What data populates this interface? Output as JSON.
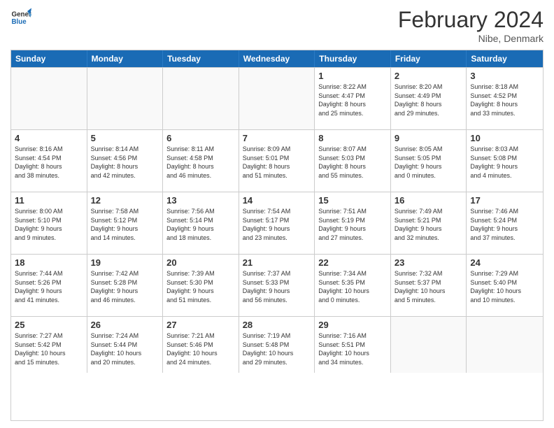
{
  "logo": {
    "line1": "General",
    "line2": "Blue"
  },
  "title": "February 2024",
  "subtitle": "Nibe, Denmark",
  "days": [
    "Sunday",
    "Monday",
    "Tuesday",
    "Wednesday",
    "Thursday",
    "Friday",
    "Saturday"
  ],
  "weeks": [
    [
      {
        "day": "",
        "info": ""
      },
      {
        "day": "",
        "info": ""
      },
      {
        "day": "",
        "info": ""
      },
      {
        "day": "",
        "info": ""
      },
      {
        "day": "1",
        "info": "Sunrise: 8:22 AM\nSunset: 4:47 PM\nDaylight: 8 hours\nand 25 minutes."
      },
      {
        "day": "2",
        "info": "Sunrise: 8:20 AM\nSunset: 4:49 PM\nDaylight: 8 hours\nand 29 minutes."
      },
      {
        "day": "3",
        "info": "Sunrise: 8:18 AM\nSunset: 4:52 PM\nDaylight: 8 hours\nand 33 minutes."
      }
    ],
    [
      {
        "day": "4",
        "info": "Sunrise: 8:16 AM\nSunset: 4:54 PM\nDaylight: 8 hours\nand 38 minutes."
      },
      {
        "day": "5",
        "info": "Sunrise: 8:14 AM\nSunset: 4:56 PM\nDaylight: 8 hours\nand 42 minutes."
      },
      {
        "day": "6",
        "info": "Sunrise: 8:11 AM\nSunset: 4:58 PM\nDaylight: 8 hours\nand 46 minutes."
      },
      {
        "day": "7",
        "info": "Sunrise: 8:09 AM\nSunset: 5:01 PM\nDaylight: 8 hours\nand 51 minutes."
      },
      {
        "day": "8",
        "info": "Sunrise: 8:07 AM\nSunset: 5:03 PM\nDaylight: 8 hours\nand 55 minutes."
      },
      {
        "day": "9",
        "info": "Sunrise: 8:05 AM\nSunset: 5:05 PM\nDaylight: 9 hours\nand 0 minutes."
      },
      {
        "day": "10",
        "info": "Sunrise: 8:03 AM\nSunset: 5:08 PM\nDaylight: 9 hours\nand 4 minutes."
      }
    ],
    [
      {
        "day": "11",
        "info": "Sunrise: 8:00 AM\nSunset: 5:10 PM\nDaylight: 9 hours\nand 9 minutes."
      },
      {
        "day": "12",
        "info": "Sunrise: 7:58 AM\nSunset: 5:12 PM\nDaylight: 9 hours\nand 14 minutes."
      },
      {
        "day": "13",
        "info": "Sunrise: 7:56 AM\nSunset: 5:14 PM\nDaylight: 9 hours\nand 18 minutes."
      },
      {
        "day": "14",
        "info": "Sunrise: 7:54 AM\nSunset: 5:17 PM\nDaylight: 9 hours\nand 23 minutes."
      },
      {
        "day": "15",
        "info": "Sunrise: 7:51 AM\nSunset: 5:19 PM\nDaylight: 9 hours\nand 27 minutes."
      },
      {
        "day": "16",
        "info": "Sunrise: 7:49 AM\nSunset: 5:21 PM\nDaylight: 9 hours\nand 32 minutes."
      },
      {
        "day": "17",
        "info": "Sunrise: 7:46 AM\nSunset: 5:24 PM\nDaylight: 9 hours\nand 37 minutes."
      }
    ],
    [
      {
        "day": "18",
        "info": "Sunrise: 7:44 AM\nSunset: 5:26 PM\nDaylight: 9 hours\nand 41 minutes."
      },
      {
        "day": "19",
        "info": "Sunrise: 7:42 AM\nSunset: 5:28 PM\nDaylight: 9 hours\nand 46 minutes."
      },
      {
        "day": "20",
        "info": "Sunrise: 7:39 AM\nSunset: 5:30 PM\nDaylight: 9 hours\nand 51 minutes."
      },
      {
        "day": "21",
        "info": "Sunrise: 7:37 AM\nSunset: 5:33 PM\nDaylight: 9 hours\nand 56 minutes."
      },
      {
        "day": "22",
        "info": "Sunrise: 7:34 AM\nSunset: 5:35 PM\nDaylight: 10 hours\nand 0 minutes."
      },
      {
        "day": "23",
        "info": "Sunrise: 7:32 AM\nSunset: 5:37 PM\nDaylight: 10 hours\nand 5 minutes."
      },
      {
        "day": "24",
        "info": "Sunrise: 7:29 AM\nSunset: 5:40 PM\nDaylight: 10 hours\nand 10 minutes."
      }
    ],
    [
      {
        "day": "25",
        "info": "Sunrise: 7:27 AM\nSunset: 5:42 PM\nDaylight: 10 hours\nand 15 minutes."
      },
      {
        "day": "26",
        "info": "Sunrise: 7:24 AM\nSunset: 5:44 PM\nDaylight: 10 hours\nand 20 minutes."
      },
      {
        "day": "27",
        "info": "Sunrise: 7:21 AM\nSunset: 5:46 PM\nDaylight: 10 hours\nand 24 minutes."
      },
      {
        "day": "28",
        "info": "Sunrise: 7:19 AM\nSunset: 5:48 PM\nDaylight: 10 hours\nand 29 minutes."
      },
      {
        "day": "29",
        "info": "Sunrise: 7:16 AM\nSunset: 5:51 PM\nDaylight: 10 hours\nand 34 minutes."
      },
      {
        "day": "",
        "info": ""
      },
      {
        "day": "",
        "info": ""
      }
    ]
  ]
}
